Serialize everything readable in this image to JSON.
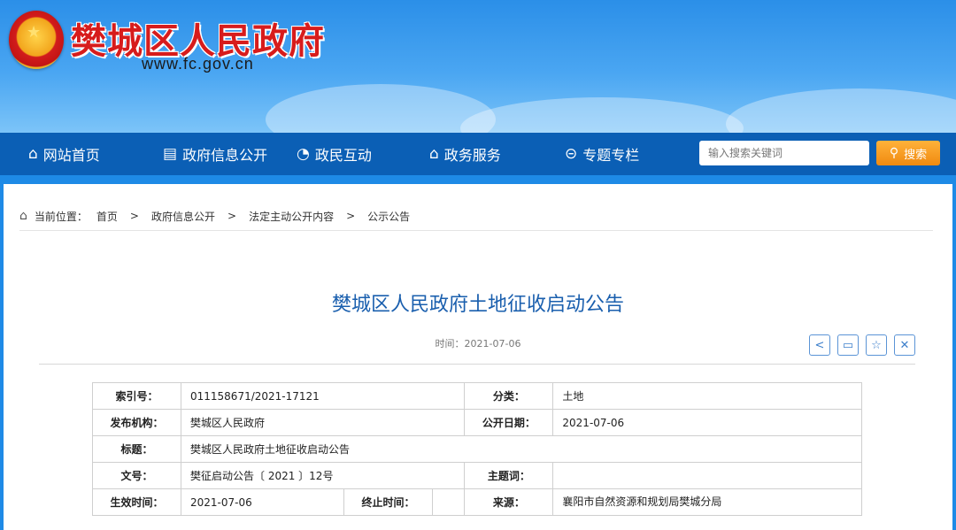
{
  "header": {
    "site_title": "樊城区人民政府",
    "site_url": "www.fc.gov.cn"
  },
  "nav": {
    "items": [
      {
        "label": "网站首页",
        "icon": "home-icon"
      },
      {
        "label": "政府信息公开",
        "icon": "document-icon"
      },
      {
        "label": "政民互动",
        "icon": "chat-icon"
      },
      {
        "label": "政务服务",
        "icon": "building-icon"
      },
      {
        "label": "专题专栏",
        "icon": "arrow-circle-icon"
      }
    ],
    "search_placeholder": "输入搜索关键词",
    "search_button": "搜索"
  },
  "breadcrumb": {
    "prefix": "当前位置：",
    "items": [
      "首页",
      "政府信息公开",
      "法定主动公开内容",
      "公示公告"
    ],
    "separator": ">"
  },
  "article": {
    "title": "樊城区人民政府土地征收启动公告",
    "time": "时间：2021-07-06"
  },
  "tools": [
    "share-icon",
    "print-icon",
    "favorite-icon",
    "close-icon"
  ],
  "meta": {
    "index_label": "索引号：",
    "index_value": "011158671/2021-17121",
    "category_label": "分类：",
    "category_value": "土地",
    "publisher_label": "发布机构：",
    "publisher_value": "樊城区人民政府",
    "pubdate_label": "公开日期：",
    "pubdate_value": "2021-07-06",
    "title_label": "标题：",
    "title_value": "樊城区人民政府土地征收启动公告",
    "docno_label": "文号：",
    "docno_value": "樊征启动公告〔 2021 〕12号",
    "subject_label": "主题词：",
    "subject_value": "",
    "effective_label": "生效时间：",
    "effective_value": "2021-07-06",
    "expire_label": "终止时间：",
    "expire_value": "",
    "source_label": "来源：",
    "source_value": "襄阳市自然资源和规划局樊城分局"
  },
  "colors": {
    "nav_bg": "#0b5fb5",
    "title_red": "#d71c1c",
    "article_title": "#1a5fae",
    "search_btn": "#f08a10"
  }
}
